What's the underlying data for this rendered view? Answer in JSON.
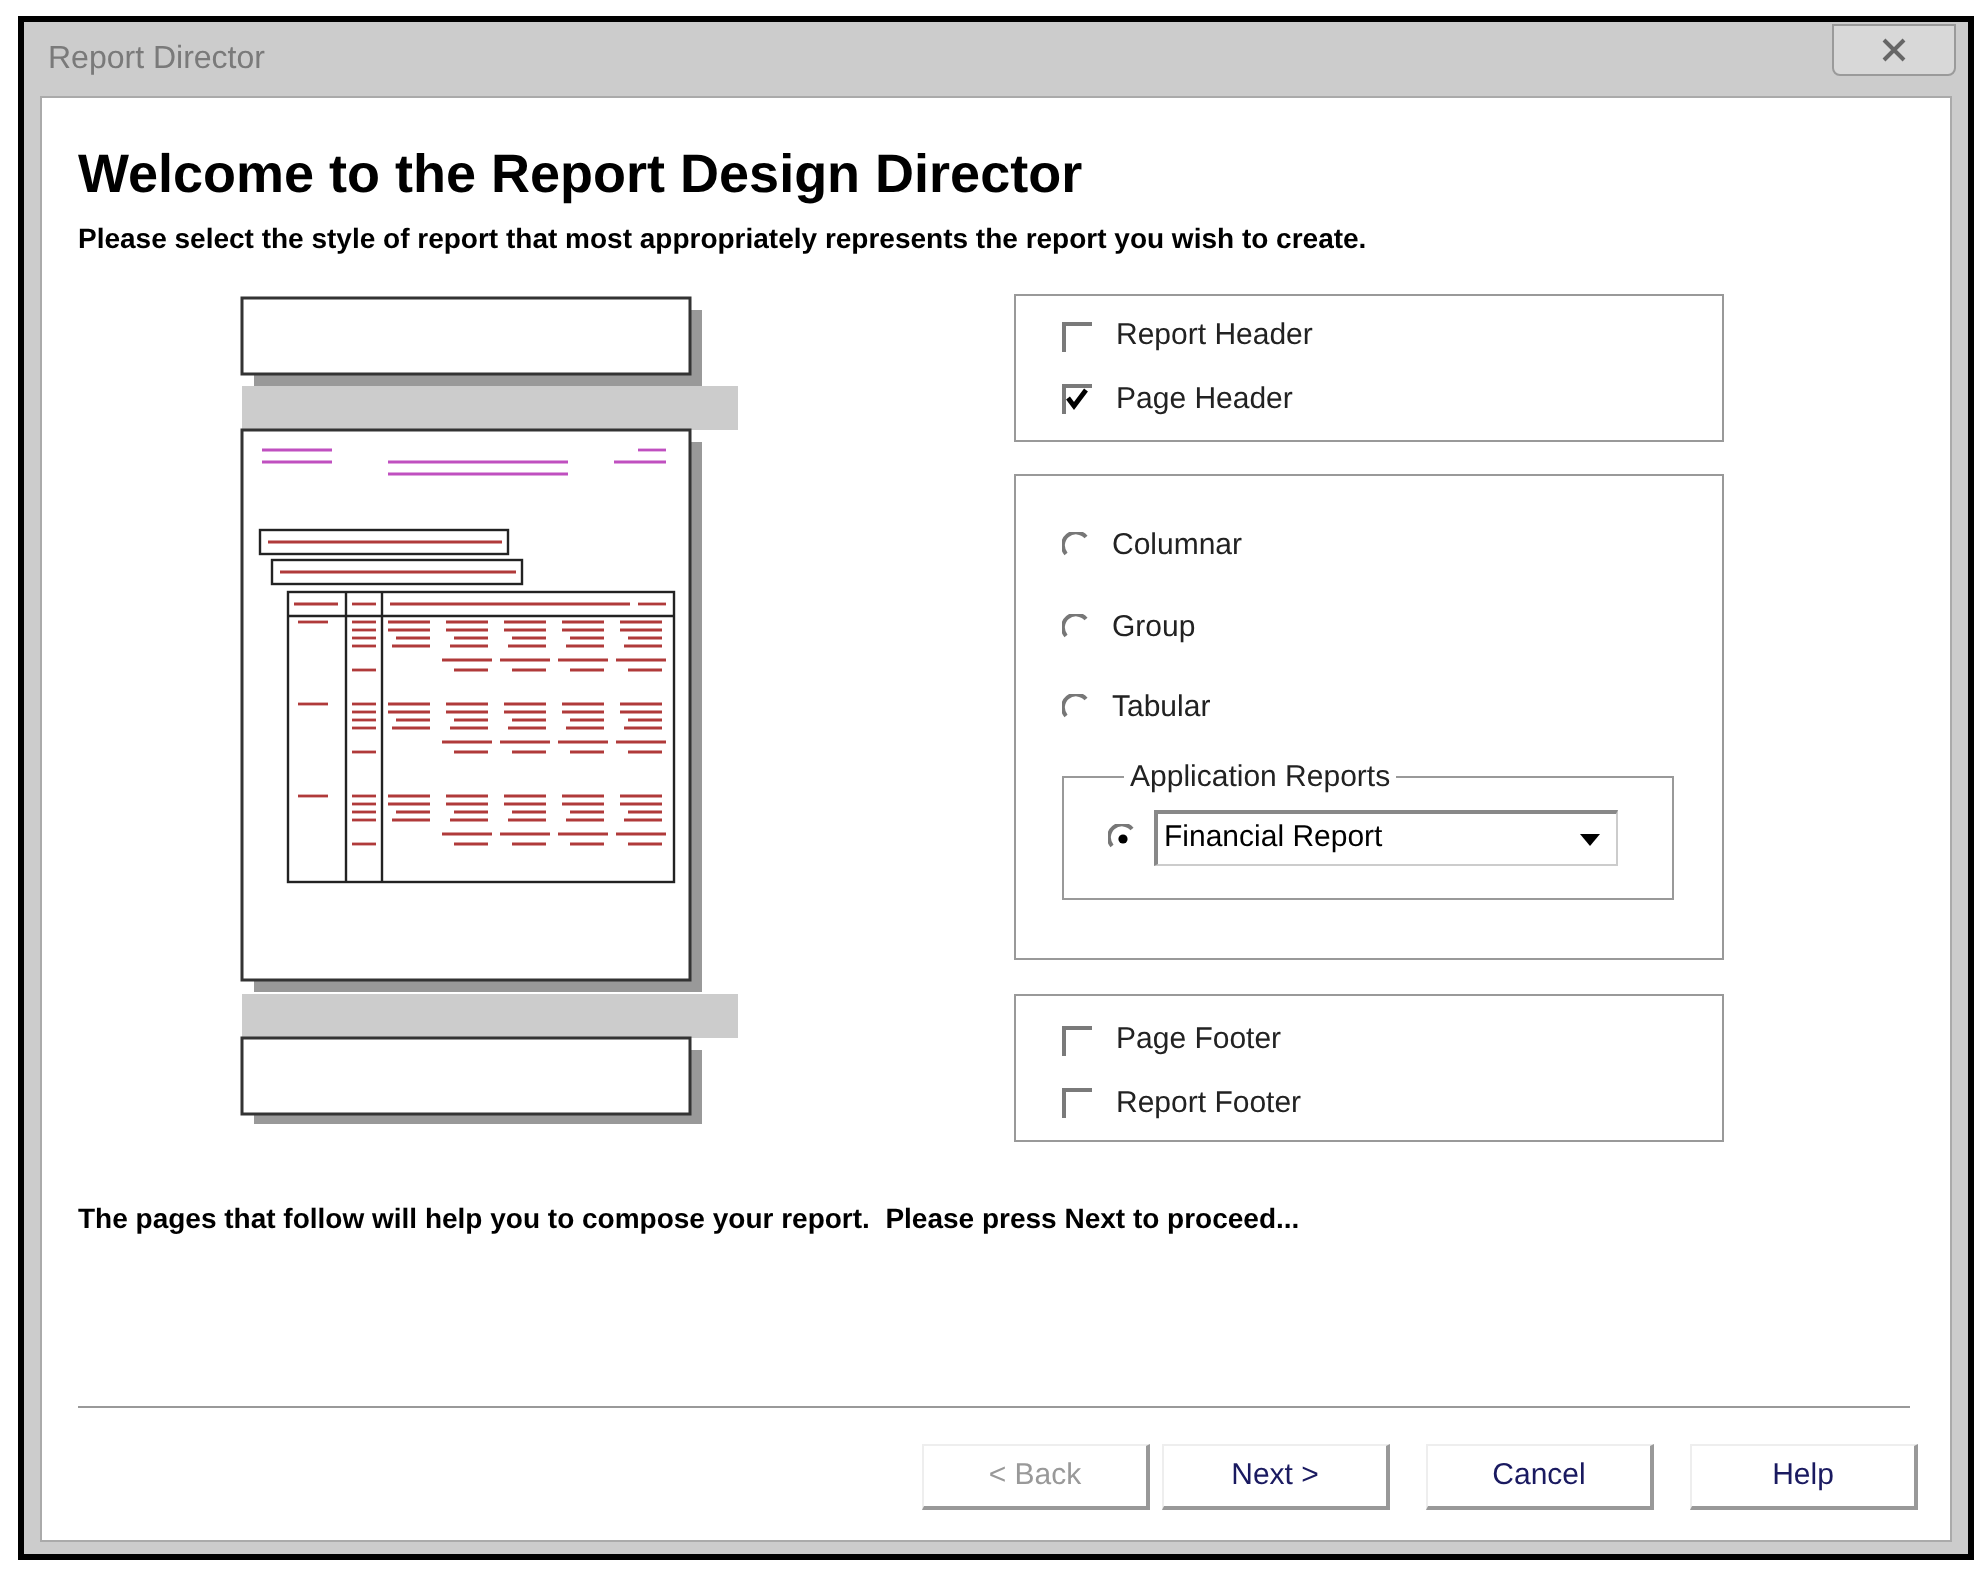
{
  "window": {
    "title": "Report Director"
  },
  "heading": "Welcome to the Report Design Director",
  "instructions": "Please select the style of report that most appropriately represents the report you wish to create.",
  "header_options": [
    {
      "label": "Report Header",
      "checked": false
    },
    {
      "label": "Page Header",
      "checked": true
    }
  ],
  "styles": [
    {
      "label": "Columnar",
      "selected": false
    },
    {
      "label": "Group",
      "selected": false
    },
    {
      "label": "Tabular",
      "selected": false
    }
  ],
  "application_reports": {
    "title": "Application Reports",
    "selected": true,
    "value": "Financial Report"
  },
  "footer_options": [
    {
      "label": "Page Footer",
      "checked": false
    },
    {
      "label": "Report Footer",
      "checked": false
    }
  ],
  "footer_text": "The pages that follow will help you to compose your report.  Please press Next to proceed...",
  "buttons": [
    {
      "label": "< Back",
      "disabled": true
    },
    {
      "label": "Next >",
      "disabled": false
    },
    {
      "label": "Cancel",
      "disabled": false
    },
    {
      "label": "Help",
      "disabled": false
    }
  ]
}
